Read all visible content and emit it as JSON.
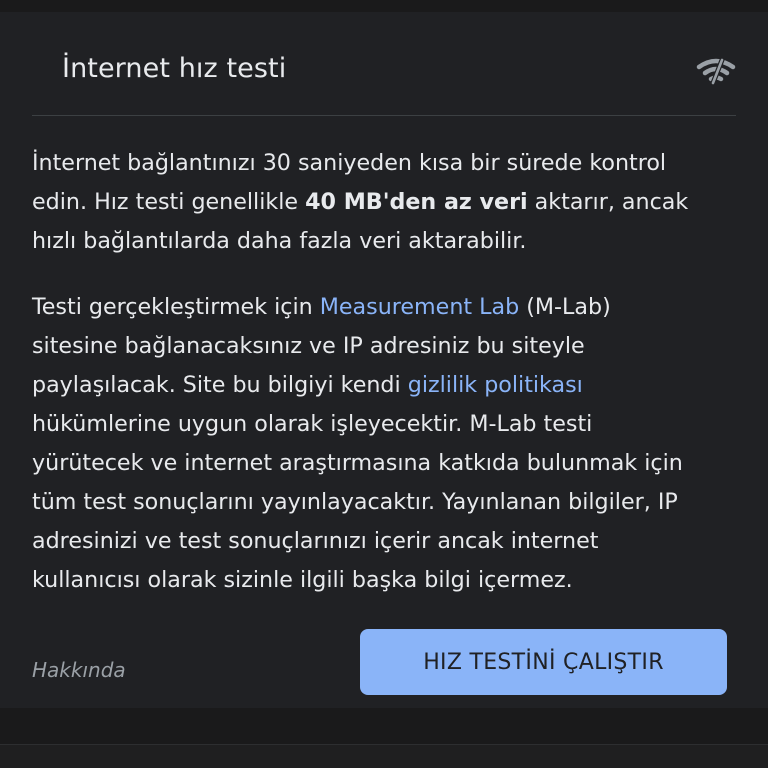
{
  "dialog": {
    "title": "İnternet hız testi",
    "header_icon": "wifi-speed-icon",
    "paragraph1": {
      "line1": "İnternet bağlantınızı 30 saniyeden kısa bir sürede kontrol",
      "line2_pre": "edin. Hız testi genellikle ",
      "line2_bold": "40 MB'den az veri",
      "line2_post": " aktarır, ancak",
      "line3": "hızlı bağlantılarda daha fazla veri aktarabilir."
    },
    "paragraph2": {
      "line1_pre": "Testi gerçekleştirmek için ",
      "line1_link": "Measurement Lab",
      "line1_post": " (M-Lab)",
      "line2": "sitesine bağlanacaksınız ve IP adresiniz bu siteyle",
      "line3_pre": "paylaşılacak. Site bu bilgiyi kendi ",
      "line3_link": "gizlilik politikası",
      "line4": "hükümlerine uygun olarak işleyecektir. M-Lab testi",
      "line5": "yürütecek ve internet araştırmasına katkıda bulunmak için",
      "line6": "tüm test sonuçlarını yayınlayacaktır. Yayınlanan bilgiler, IP",
      "line7": "adresinizi ve test sonuçlarınızı içerir ancak internet",
      "line8": "kullanıcısı olarak sizinle ilgili başka bilgi içermez."
    },
    "footer_link": "Hakkında",
    "run_button": "HIZ TESTİNİ ÇALIŞTIR"
  },
  "colors": {
    "background": "#202124",
    "text": "#e8eaed",
    "link": "#8ab4f8",
    "muted": "#9aa0a6",
    "button": "#8ab4f8"
  }
}
